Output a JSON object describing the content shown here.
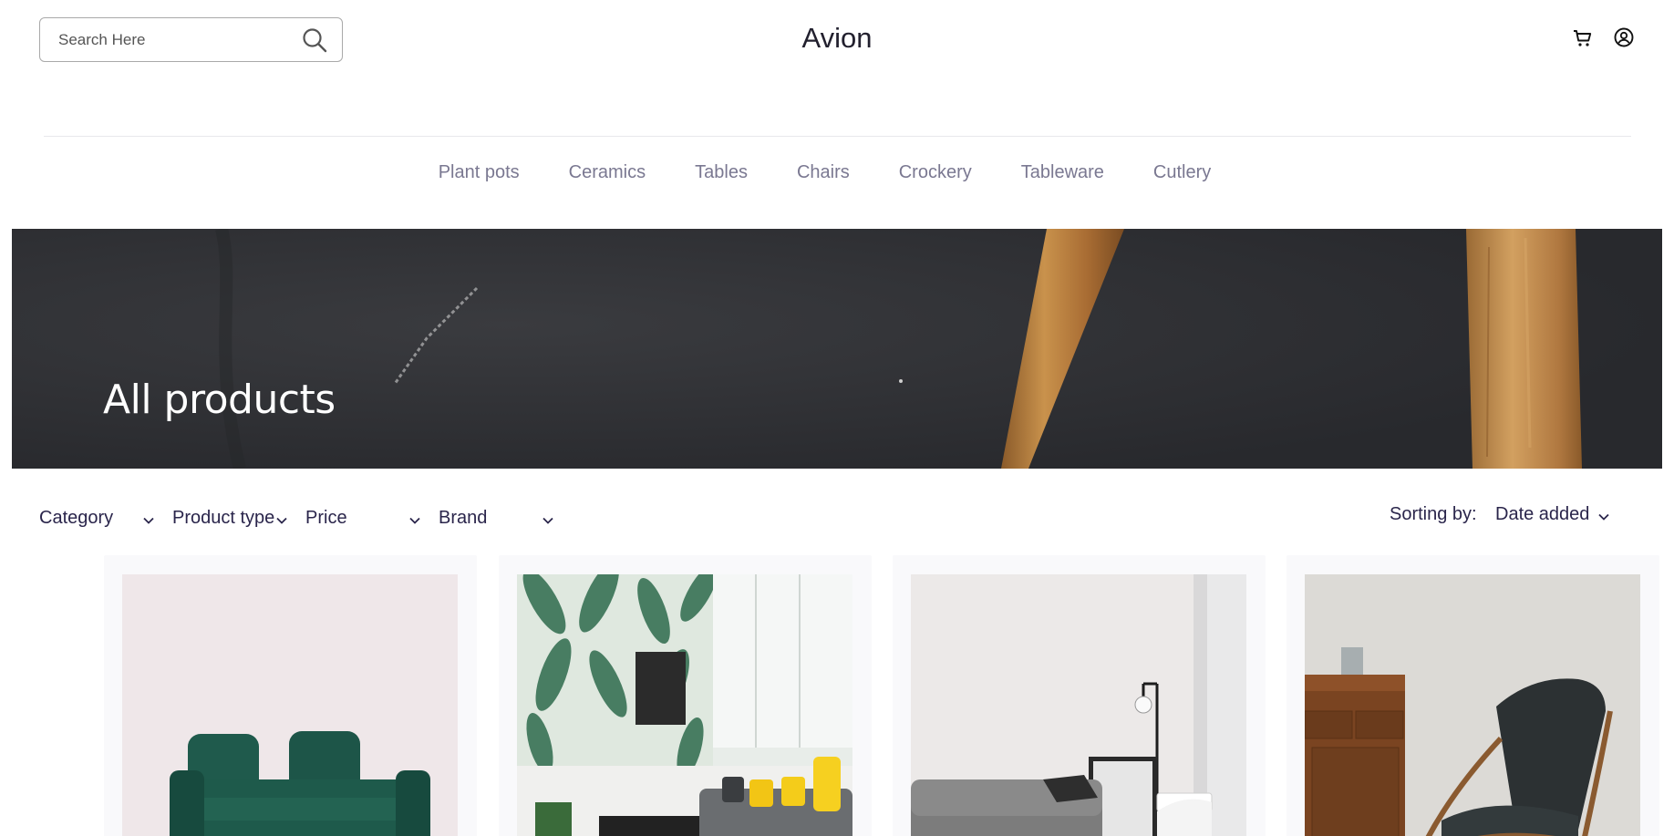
{
  "header": {
    "search": {
      "placeholder": "Search Here"
    },
    "brand": "Avion",
    "icons": [
      "search-icon",
      "cart-icon",
      "user-icon"
    ]
  },
  "nav": {
    "items": [
      "Plant pots",
      "Ceramics",
      "Tables",
      "Chairs",
      "Crockery",
      "Tableware",
      "Cutlery"
    ]
  },
  "banner": {
    "title": "All products"
  },
  "filters": {
    "items": [
      "Category",
      "Product type",
      "Price",
      "Brand"
    ],
    "sorting_label": "Sorting by:",
    "sorting_value": "Date added"
  },
  "products": [
    {
      "image": "green velvet sofa"
    },
    {
      "image": "living room with leaf wallpaper"
    },
    {
      "image": "grey sofa with floor lamp"
    },
    {
      "image": "dark lounge chair"
    }
  ],
  "colors": {
    "text_primary": "#2a254b",
    "nav_text": "#7a7891",
    "banner_bg": "#2f3034",
    "card_bg": "#f9f9fb"
  }
}
